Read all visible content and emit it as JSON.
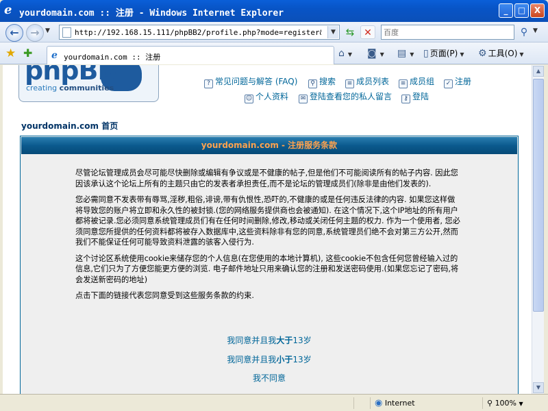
{
  "window": {
    "title": "yourdomain.com :: 注册 - Windows Internet Explorer",
    "controls": {
      "minimize": "_",
      "maximize": "□",
      "close": "X"
    }
  },
  "nav": {
    "back_icon": "arrow-left-icon",
    "forward_icon": "arrow-right-icon",
    "address": "http://192.168.15.111/phpBB2/profile.php?mode=register&sid=31",
    "search_placeholder": "百度",
    "colors": {
      "refresh": "#2d9a2d",
      "stop": "#d12b1f"
    }
  },
  "tabs": {
    "active_label": "yourdomain.com :: 注册"
  },
  "toolbar": {
    "page_label": "页面(P)",
    "tools_label": "工具(O)"
  },
  "forum": {
    "logo_text": "phpBB",
    "logo_tagline_1": "creating",
    "logo_tagline_2": "communities",
    "links": {
      "faq": "常见问题与解答 (FAQ)",
      "search": "搜索",
      "memberlist": "成员列表",
      "groups": "成员组",
      "register": "注册",
      "profile": "个人资料",
      "pm": "登陆查看您的私人留言",
      "login": "登陆"
    },
    "home_link": "yourdomain.com 首页",
    "panel_title": "yourdomain.com - 注册服务条款",
    "paragraphs": [
      "尽管论坛管理成员会尽可能尽快删除或编辑有争议或是不健康的帖子,但是他们不可能阅读所有的帖子内容. 因此您因该承认这个论坛上所有的主题只由它的发表者承担责任,而不是论坛的管理成员们(除非是由他们发表的).",
      "您必需同意不发表带有辱骂,淫秽,粗俗,诽谤,带有仇恨性,恐吓的,不健康的或是任何违反法律的内容. 如果您这样做将导致您的账户将立即和永久性的被封锁.(您的网络服务提供商也会被通知). 在这个情况下,这个IP地址的所有用户都将被记录.您必须同意系统管理成员们有在任何时间删除,修改,移动或关闭任何主题的权力. 作为一个使用者, 您必须同意您所提供的任何资料都将被存入数据库中,这些资料除非有您的同意,系统管理员们绝不会对第三方公开,然而我们不能保证任何可能导致资料泄露的骇客入侵行为.",
      "这个讨论区系统使用cookie来储存您的个人信息(在您使用的本地计算机), 这些cookie不包含任何您曾经输入过的信息,它们只为了方便您能更方便的浏览. 电子邮件地址只用来确认您的注册和发送密码使用.(如果您忘记了密码,将会发送新密码的地址)",
      "点击下面的链接代表您同意受到这些服务条款的约束."
    ],
    "agree_over13": {
      "pre": "我同意并且我",
      "bold": "大于",
      "post": "13岁"
    },
    "agree_under13": {
      "pre": "我同意并且我",
      "bold": "小于",
      "post": "13岁"
    },
    "disagree": "我不同意"
  },
  "status": {
    "zone": "Internet",
    "zoom": "100%"
  },
  "colors": {
    "titlebar": "#0854c6",
    "panel_header": "#0b5a8e",
    "panel_title": "#ffa34f",
    "link": "#006699",
    "home": "#003366"
  }
}
